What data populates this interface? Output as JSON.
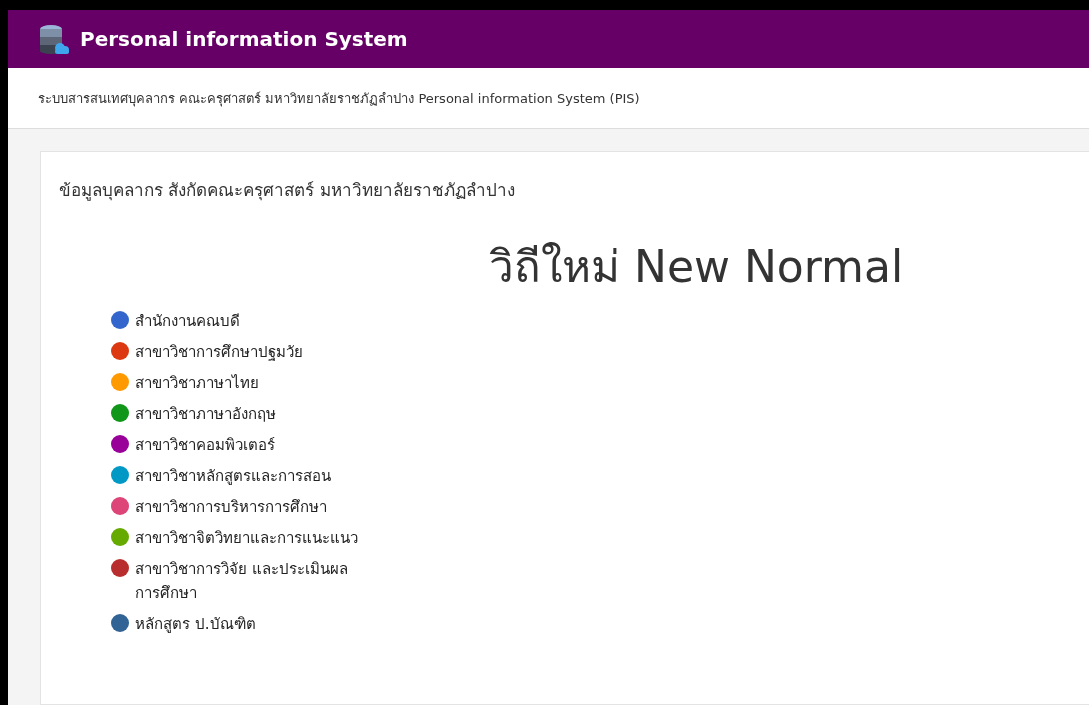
{
  "header": {
    "title": "Personal information System"
  },
  "subtitle": "ระบบสารสนเทศบุคลากร คณะครุศาสตร์ มหาวิทยาลัยราชภัฏลำปาง Personal information System (PIS)",
  "card": {
    "title": "ข้อมูลบุคลากร สังกัดคณะครุศาสตร์ มหาวิทยาลัยราชภัฏลำปาง",
    "chart_title": "วิถีใหม่ New Normal",
    "legend": [
      {
        "label": "สำนักงานคณบดี",
        "color": "#3366cc"
      },
      {
        "label": "สาขาวิชาการศึกษาปฐมวัย",
        "color": "#dc3912"
      },
      {
        "label": "สาขาวิชาภาษาไทย",
        "color": "#ff9900"
      },
      {
        "label": "สาขาวิชาภาษาอังกฤษ",
        "color": "#109618"
      },
      {
        "label": "สาขาวิชาคอมพิวเตอร์",
        "color": "#990099"
      },
      {
        "label": "สาขาวิชาหลักสูตรและการสอน",
        "color": "#0099c6"
      },
      {
        "label": "สาขาวิชาการบริหารการศึกษา",
        "color": "#dd4477"
      },
      {
        "label": "สาขาวิชาจิตวิทยาและการแนะแนว",
        "color": "#66aa00"
      },
      {
        "label": "สาขาวิชาการวิจัย และประเมินผลการศึกษา",
        "color": "#b82e2e"
      },
      {
        "label": "หลักสูตร ป.บัณฑิต",
        "color": "#316395"
      }
    ]
  }
}
